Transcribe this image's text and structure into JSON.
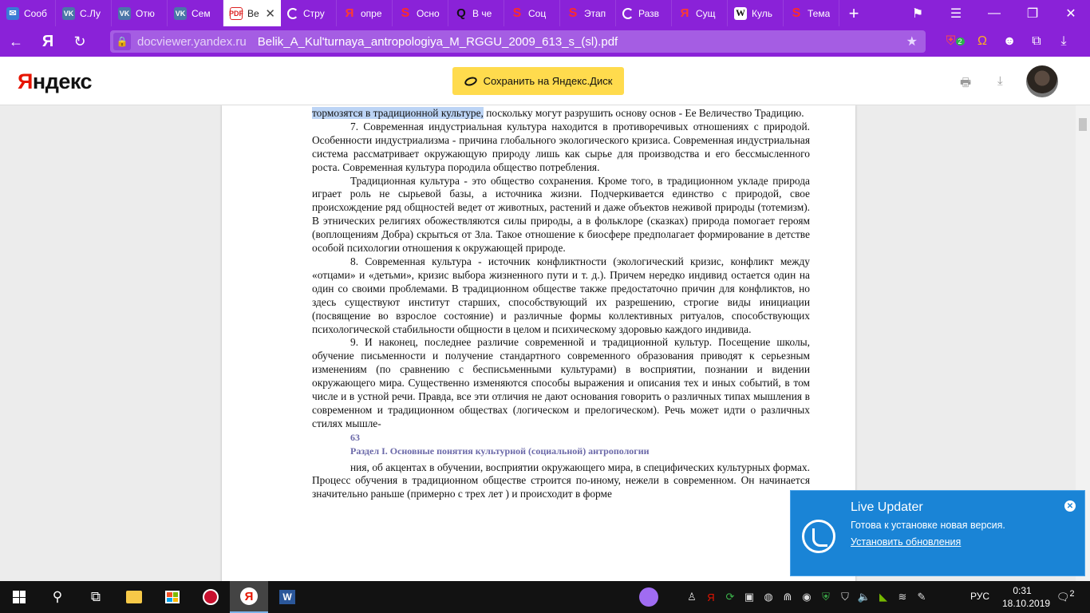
{
  "tabs": [
    {
      "icon": "message-icon",
      "title": "Сооб"
    },
    {
      "icon": "vk-icon",
      "title": "С.Лу"
    },
    {
      "icon": "vk-icon",
      "title": "Отю"
    },
    {
      "icon": "vk-icon",
      "title": "Сем"
    },
    {
      "icon": "pdf-icon",
      "title": "Ве",
      "active": true
    },
    {
      "icon": "loading-icon",
      "title": "Стру"
    },
    {
      "icon": "yandex-icon",
      "title": "опре"
    },
    {
      "icon": "s-icon",
      "title": "Осно"
    },
    {
      "icon": "q-icon",
      "title": "В че"
    },
    {
      "icon": "s-icon",
      "title": "Соц"
    },
    {
      "icon": "s-icon",
      "title": "Этап"
    },
    {
      "icon": "loading-icon",
      "title": "Разв"
    },
    {
      "icon": "yandex-icon",
      "title": "Сущ"
    },
    {
      "icon": "wikipedia-icon",
      "title": "Куль"
    },
    {
      "icon": "s-icon",
      "title": "Тема"
    }
  ],
  "addressbar": {
    "domain": "docviewer.yandex.ru",
    "path": "Belik_A_Kul'turnaya_antropologiya_M_RGGU_2009_613_s_(sl).pdf",
    "ext_badge": "2"
  },
  "viewer": {
    "logo_first": "Я",
    "logo_rest": "ндекс",
    "save_label": "Сохранить на Яндекс.Диск"
  },
  "document": {
    "p0_highlight": "тормозятся в традиционной культуре,",
    "p0_rest": " поскольку могут разрушить основу основ - Ее Величество Традицию.",
    "p1": "7. Современная индустриальная культура находится в противоречивых отношениях с природой. Особенности индустриализма - причина глобального экологического кризиса. Современная индустриальная система рассматривает окружающую природу лишь как сырье для производства и его бессмысленного роста. Современная культура породила общество потребления.",
    "p2": "Традиционная культура - это общество сохранения. Кроме того, в традиционном укладе природа играет роль не сырьевой базы, а источника жизни. Подчеркивается единство с природой, свое происхождение ряд общностей ведет от животных, растений и даже объектов неживой природы (тотемизм). В этнических религиях обожествляются силы природы, а в фольклоре (сказках) природа помогает героям (воплощениям Добра) скрыться от Зла. Такое отношение к биосфере предполагает формирование в детстве особой психологии отношения к окружающей природе.",
    "p3": "8. Современная культура - источник конфликтности (экологический кризис, конфликт между «отцами» и «детьми», кризис выбора жизненного пути и т. д.). Причем нередко индивид остается один на один со своими проблемами. В традиционном обществе также предостаточно причин для конфликтов, но здесь существуют институт старших, способствующий их разрешению, строгие виды инициации (посвящение во взрослое состояние) и различные формы коллективных ритуалов, способствующих психологической стабильности общности в целом и психическому здоровью каждого индивида.",
    "p4": "9. И наконец, последнее различие современной и традиционной культур. Посещение школы, обучение письменности и получение стандартного современного образования приводят к серьезным изменениям (по сравнению с бесписьменными культурами) в восприятии, познании и видении окружающего мира. Существенно изменяются способы выражения и описания тех и иных событий, в том числе и в устной речи. Правда, все эти отличия не дают основания говорить о различных типах мышления в современном и традиционном обществах (логическом и прелогическом). Речь может идти о различных стилях мышле-",
    "page_number": "63",
    "section_title": "Раздел I. Основные понятия культурной (социальной) антропологии",
    "p5": "ния, об акцентах в обучении, восприятии окружающего мира, в специфических культурных формах. Процесс обучения в традиционном обществе строится по-иному, нежели в современном. Он начинается значительно раньше (примерно с трех лет ) и происходит в форме"
  },
  "notification": {
    "title": "Live Updater",
    "message": "Готова к установке новая версия.",
    "link": "Установить обновления"
  },
  "taskbar": {
    "yandex_letter": "Я",
    "word_letter": "W",
    "lang": "РУС",
    "time": "0:31",
    "date": "18.10.2019",
    "notifications_count": "2"
  },
  "colors": {
    "browser_chrome": "#8a22d8",
    "save_button": "#ffdb4d",
    "notification": "#1a84d6",
    "highlight": "#bcd4f5"
  }
}
